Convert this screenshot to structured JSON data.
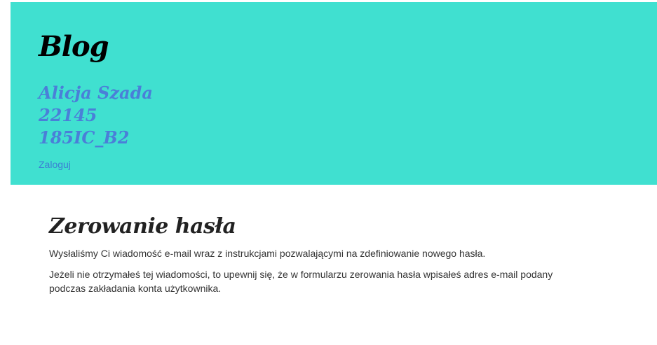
{
  "header": {
    "blog_title": "Blog",
    "author_lines": [
      "Alicja Szada",
      "22145",
      "185IC_B2"
    ],
    "login_link": "Zaloguj",
    "background_color": "#40e0d0",
    "accent_color": "#4a7fd8"
  },
  "main": {
    "title": "Zerowanie hasła",
    "paragraphs": [
      "Wysłaliśmy Ci wiadomość e-mail wraz z instrukcjami pozwalającymi na zdefiniowanie nowego hasła.",
      "Jeżeli nie otrzymałeś tej wiadomości, to upewnij się, że w formularzu zerowania hasła wpisałeś adres e-mail podany podczas zakładania konta użytkownika."
    ]
  }
}
